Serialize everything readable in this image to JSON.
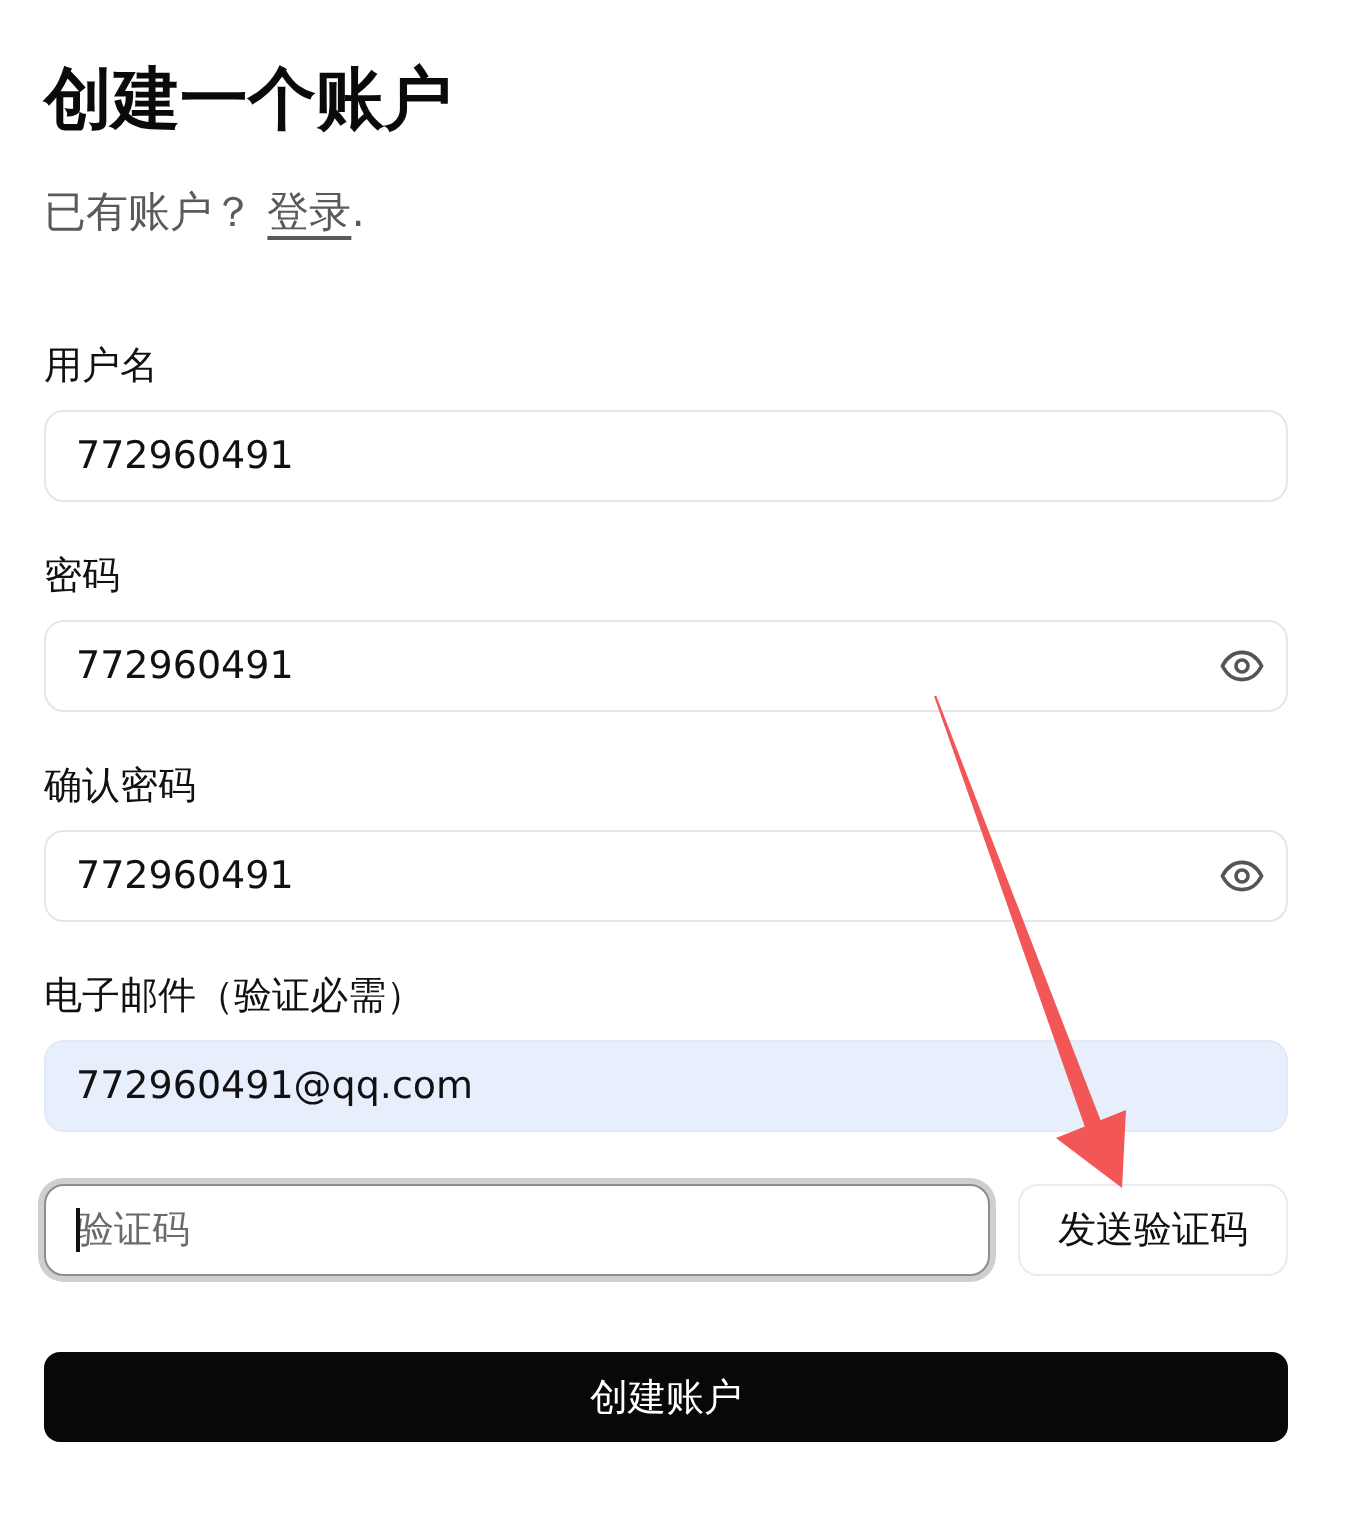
{
  "title": "创建一个账户",
  "subtitle": {
    "text": "已有账户？",
    "link": "登录",
    "after": "."
  },
  "fields": [
    {
      "kind": "text",
      "label": "用户名",
      "value": "772960491",
      "autofilled": false
    },
    {
      "kind": "password",
      "label": "密码",
      "value": "772960491",
      "revealed": true,
      "autofilled": false
    },
    {
      "kind": "password",
      "label": "确认密码",
      "value": "772960491",
      "revealed": true,
      "autofilled": false
    },
    {
      "kind": "email",
      "label": "电子邮件（验证必需）",
      "value": "772960491@qq.com",
      "autofilled": true
    }
  ],
  "code": {
    "placeholder": "验证码",
    "focused": true,
    "button": "发送验证码"
  },
  "submit": "创建账户"
}
